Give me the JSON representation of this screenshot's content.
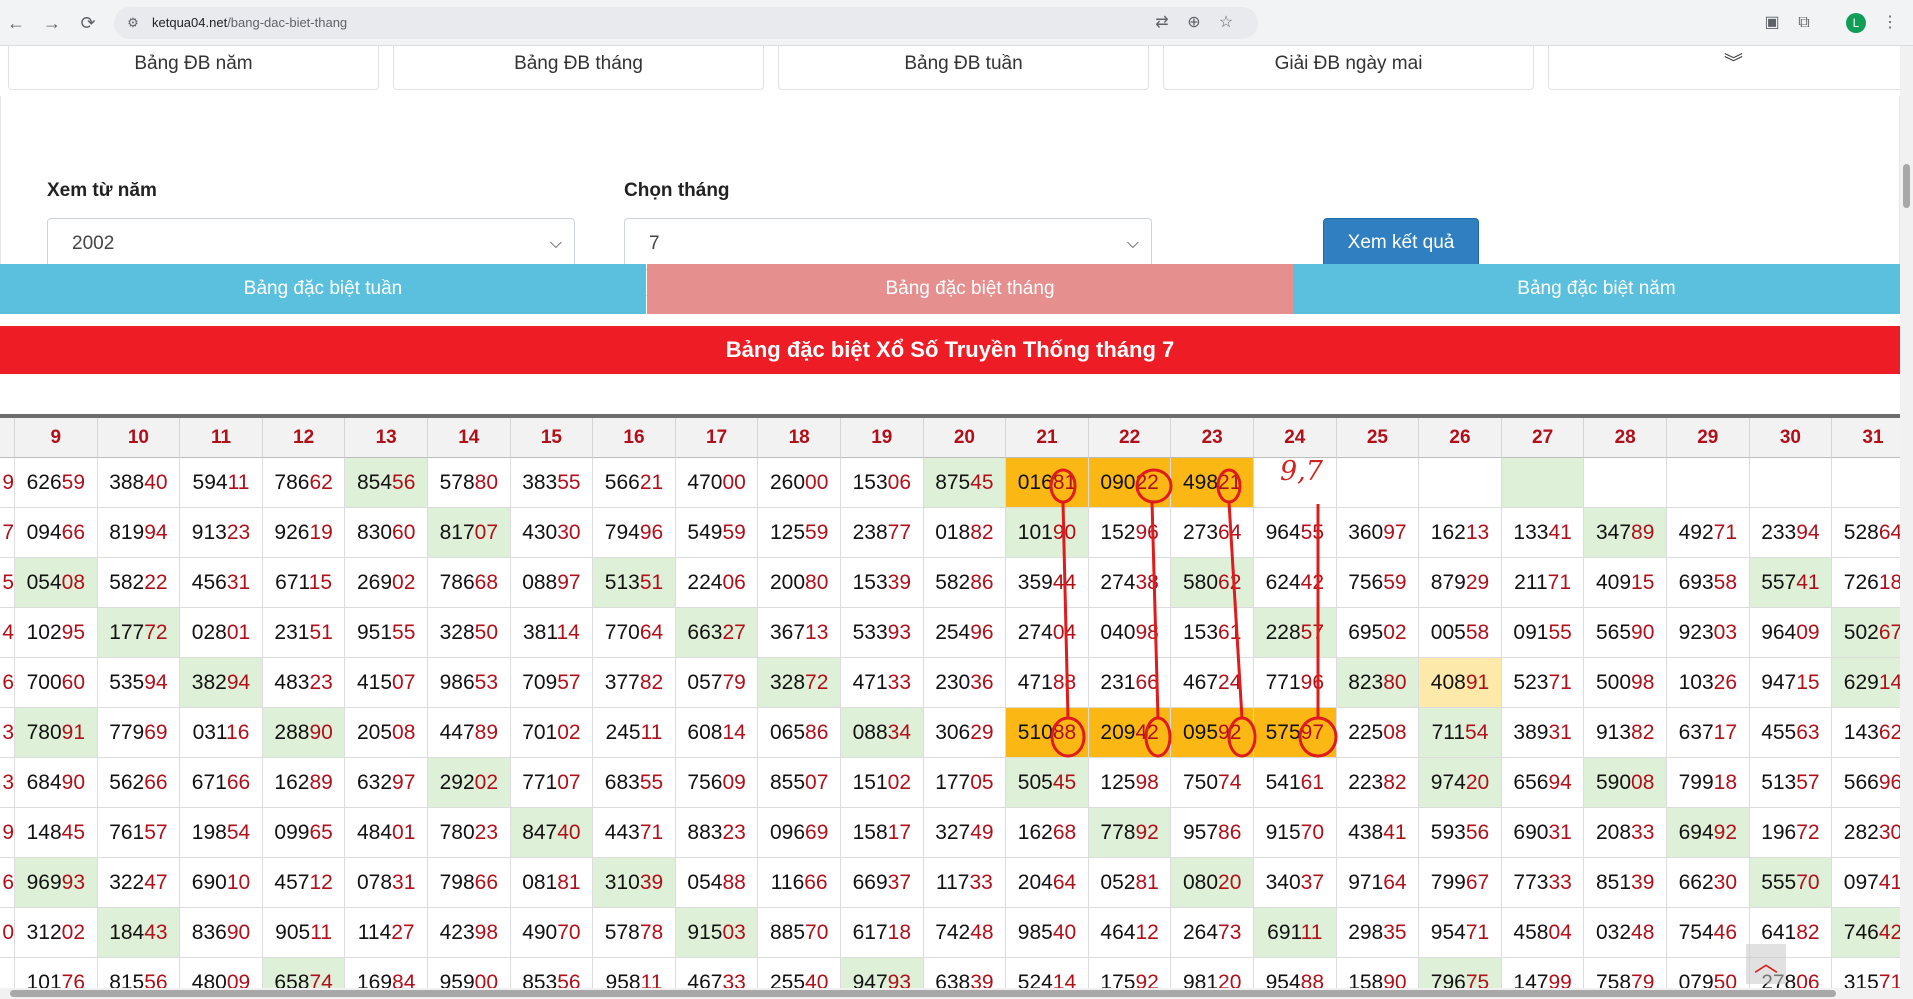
{
  "browser": {
    "url_host": "ketqua04.net",
    "url_path": "/bang-dac-biet-thang",
    "profile_initial": "L"
  },
  "top_tabs": [
    "Bảng ĐB năm",
    "Bảng ĐB tháng",
    "Bảng ĐB tuần",
    "Giải ĐB ngày mai"
  ],
  "form": {
    "year_label": "Xem từ năm",
    "year_value": "2002",
    "month_label": "Chọn tháng",
    "month_value": "7",
    "submit_label": "Xem kết quả"
  },
  "view_tabs": [
    {
      "label": "Bảng đặc biệt tuần",
      "color": "#5bc0de"
    },
    {
      "label": "Bảng đặc biệt tháng",
      "color": "#e68f8f"
    },
    {
      "label": "Bảng đặc biệt năm",
      "color": "#5bc0de"
    }
  ],
  "banner": "Bảng đặc biệt Xổ Số Truyền Thống tháng 7",
  "annotation": "9,7",
  "table": {
    "columns": [
      "9",
      "10",
      "11",
      "12",
      "13",
      "14",
      "15",
      "16",
      "17",
      "18",
      "19",
      "20",
      "21",
      "22",
      "23",
      "24",
      "25",
      "26",
      "27",
      "28",
      "29",
      "30",
      "31"
    ],
    "left_edge": [
      "9",
      "7",
      "5",
      "4",
      "6",
      "3",
      "3",
      "9",
      "6",
      "0"
    ],
    "rows": [
      [
        "62659",
        "38840",
        "59411",
        "78662",
        "85456",
        "57880",
        "38355",
        "56621",
        "47000",
        "26000",
        "15306",
        "87545",
        "01681",
        "09022",
        "49821",
        "",
        "",
        "",
        "",
        "",
        "",
        "",
        ""
      ],
      [
        "09466",
        "81994",
        "91323",
        "92619",
        "83060",
        "81707",
        "43030",
        "79496",
        "54959",
        "12559",
        "23877",
        "01882",
        "10190",
        "15296",
        "27364",
        "96455",
        "36097",
        "16213",
        "13341",
        "34789",
        "49271",
        "23394",
        "52864"
      ],
      [
        "05408",
        "58222",
        "45631",
        "67115",
        "26902",
        "78668",
        "08897",
        "51351",
        "22406",
        "20080",
        "15339",
        "58286",
        "35944",
        "27438",
        "58062",
        "62442",
        "75659",
        "87929",
        "21171",
        "40915",
        "69358",
        "55741",
        "72618"
      ],
      [
        "10295",
        "17772",
        "02801",
        "23151",
        "95155",
        "32850",
        "38114",
        "77064",
        "66327",
        "36713",
        "53393",
        "25496",
        "27404",
        "04098",
        "15361",
        "22857",
        "69502",
        "00558",
        "09155",
        "56590",
        "92303",
        "96409",
        "50267"
      ],
      [
        "70060",
        "53594",
        "38294",
        "48323",
        "41507",
        "98653",
        "70957",
        "37782",
        "05779",
        "32872",
        "47133",
        "23036",
        "47188",
        "23166",
        "46724",
        "77196",
        "82380",
        "40891",
        "52371",
        "50098",
        "10326",
        "94715",
        "62914"
      ],
      [
        "78091",
        "77969",
        "03116",
        "28890",
        "20508",
        "44789",
        "70102",
        "24511",
        "60814",
        "06586",
        "08834",
        "30629",
        "51088",
        "20942",
        "09592",
        "57597",
        "22508",
        "71154",
        "38931",
        "91382",
        "63717",
        "45563",
        "14362"
      ],
      [
        "68490",
        "56266",
        "67166",
        "16289",
        "63297",
        "29202",
        "77107",
        "68355",
        "75609",
        "85507",
        "15102",
        "17705",
        "50545",
        "12598",
        "75074",
        "54161",
        "22382",
        "97420",
        "65694",
        "59008",
        "79918",
        "51357",
        "56696"
      ],
      [
        "14845",
        "76157",
        "19854",
        "09965",
        "48401",
        "78023",
        "84740",
        "44371",
        "88323",
        "09669",
        "15817",
        "32749",
        "16268",
        "77892",
        "95786",
        "91570",
        "43841",
        "59356",
        "69031",
        "20833",
        "69492",
        "19672",
        "28230"
      ],
      [
        "96993",
        "32247",
        "69010",
        "45712",
        "07831",
        "79866",
        "08181",
        "31039",
        "05488",
        "11666",
        "66937",
        "11733",
        "20464",
        "05281",
        "08020",
        "34037",
        "97164",
        "79967",
        "77333",
        "85139",
        "66230",
        "55570",
        "09741"
      ],
      [
        "31202",
        "18443",
        "83690",
        "90511",
        "11427",
        "42398",
        "49070",
        "57878",
        "91503",
        "88570",
        "61718",
        "74248",
        "98540",
        "46412",
        "26473",
        "69111",
        "29835",
        "95471",
        "45804",
        "03248",
        "75446",
        "64182",
        "74642"
      ],
      [
        "10176",
        "81556",
        "48009",
        "65874",
        "16984",
        "95900",
        "85356",
        "95811",
        "46733",
        "25540",
        "94793",
        "63839",
        "52414",
        "17592",
        "98120",
        "95488",
        "15890",
        "79675",
        "14799",
        "75879",
        "07950",
        "27806",
        "31571"
      ]
    ],
    "highlight": {
      "green": [
        [
          0,
          4
        ],
        [
          1,
          5
        ],
        [
          2,
          0
        ],
        [
          2,
          7
        ],
        [
          3,
          1
        ],
        [
          3,
          8
        ],
        [
          4,
          2
        ],
        [
          4,
          9
        ],
        [
          5,
          3
        ],
        [
          5,
          10
        ],
        [
          6,
          5
        ],
        [
          6,
          12
        ],
        [
          6,
          19
        ],
        [
          7,
          6
        ],
        [
          7,
          13
        ],
        [
          7,
          20
        ],
        [
          8,
          0
        ],
        [
          8,
          7
        ],
        [
          8,
          14
        ],
        [
          8,
          21
        ],
        [
          9,
          1
        ],
        [
          9,
          8
        ],
        [
          9,
          15
        ],
        [
          9,
          22
        ],
        [
          0,
          11
        ],
        [
          1,
          19
        ],
        [
          2,
          14
        ],
        [
          2,
          21
        ],
        [
          3,
          15
        ],
        [
          3,
          22
        ],
        [
          4,
          16
        ],
        [
          5,
          17
        ],
        [
          6,
          17
        ],
        [
          10,
          3
        ],
        [
          10,
          10
        ],
        [
          10,
          17
        ],
        [
          0,
          18
        ],
        [
          4,
          22
        ],
        [
          1,
          12
        ],
        [
          5,
          0
        ]
      ],
      "orange": [
        [
          0,
          12
        ],
        [
          0,
          13
        ],
        [
          0,
          14
        ],
        [
          5,
          12
        ],
        [
          5,
          13
        ],
        [
          5,
          14
        ],
        [
          5,
          15
        ]
      ],
      "yellow": [
        [
          4,
          17
        ]
      ]
    }
  }
}
